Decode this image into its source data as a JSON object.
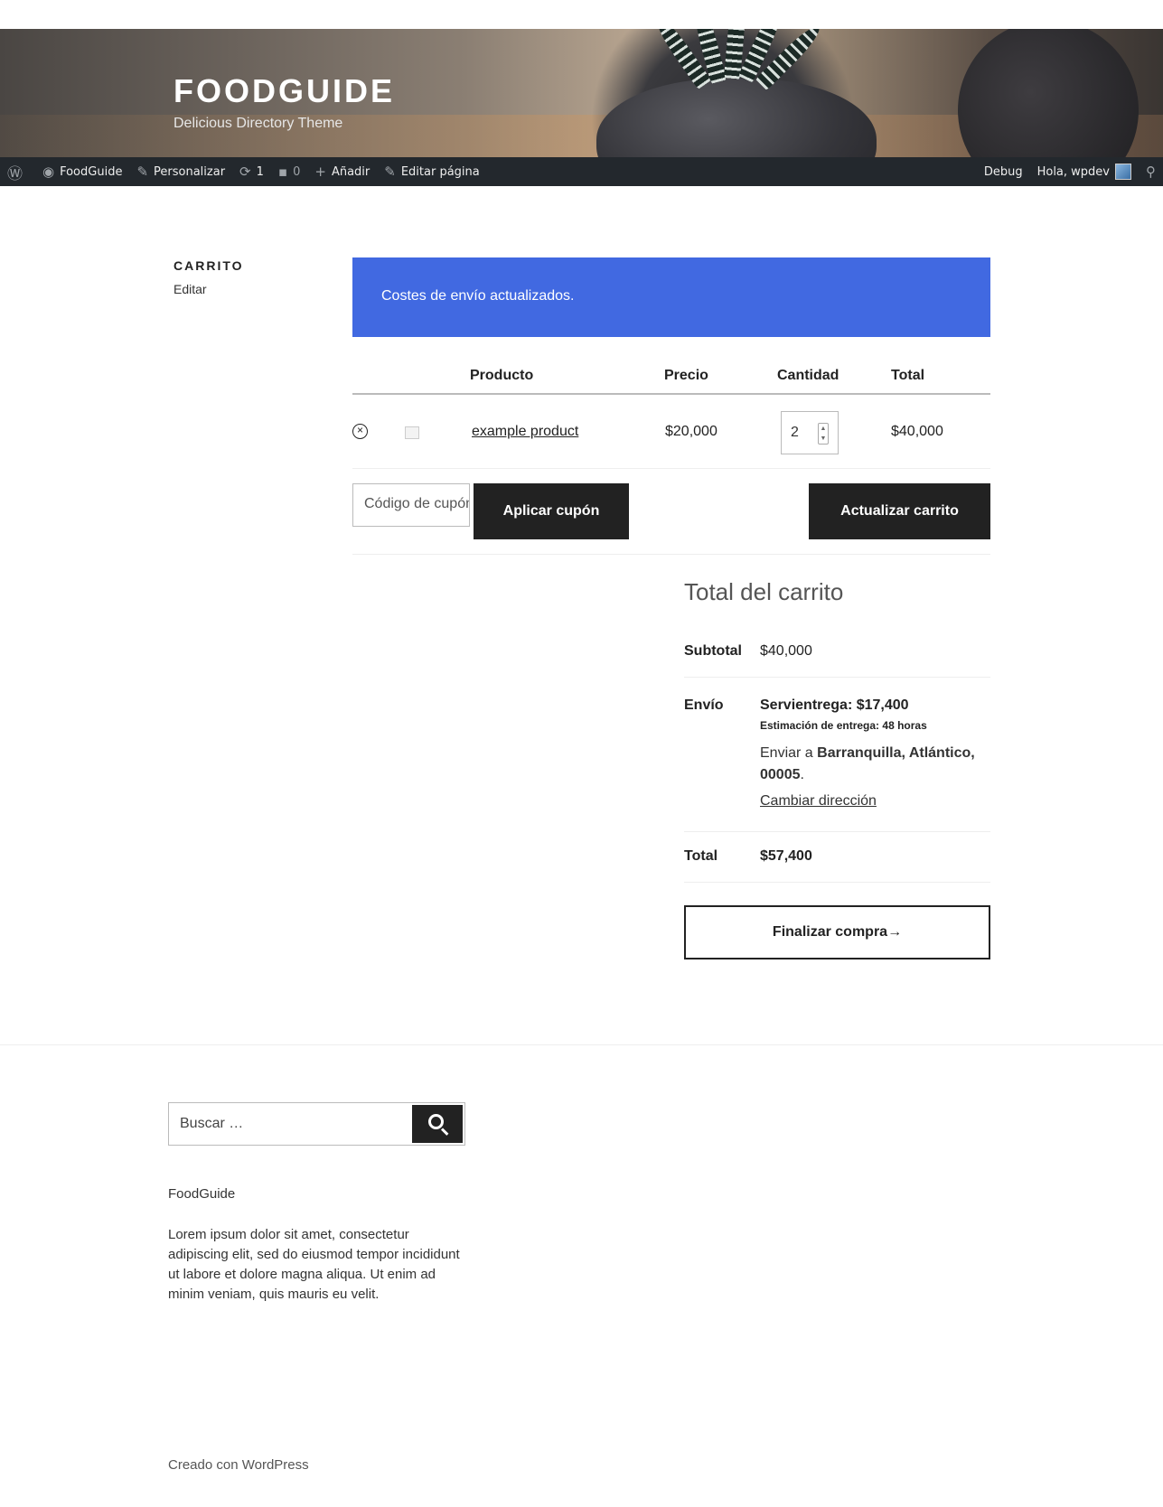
{
  "site": {
    "title": "FOODGUIDE",
    "description": "Delicious Directory Theme"
  },
  "adminbar": {
    "wp_logo_icon": "wordpress-logo-icon",
    "site_name": "FoodGuide",
    "customize": "Personalizar",
    "updates_count": "1",
    "comments_count": "0",
    "add_new": "Añadir",
    "edit_page": "Editar página",
    "debug": "Debug",
    "greeting": "Hola, wpdev"
  },
  "page": {
    "heading": "CARRITO",
    "edit_link": "Editar"
  },
  "notice": {
    "message": "Costes de envío actualizados.",
    "color": "#4169e1"
  },
  "cart": {
    "columns": [
      "Producto",
      "Precio",
      "Cantidad",
      "Total"
    ],
    "items": [
      {
        "name": "example product",
        "price": "$20,000",
        "quantity": "2",
        "total": "$40,000"
      }
    ],
    "coupon_placeholder": "Código de cupón",
    "apply_coupon": "Aplicar cupón",
    "update_cart": "Actualizar carrito"
  },
  "totals": {
    "title": "Total del carrito",
    "subtotal_label": "Subtotal",
    "subtotal_value": "$40,000",
    "shipping_label": "Envío",
    "shipping_method": "Servientrega: $17,400",
    "eta_label": "Estimación de entrega:",
    "eta_value": "48 horas",
    "ship_to_prefix": "Enviar a",
    "ship_to_address": "Barranquilla, Atlántico, 00005",
    "ship_to_suffix": ".",
    "change_address": "Cambiar dirección",
    "total_label": "Total",
    "total_value": "$57,400",
    "checkout": "Finalizar compra",
    "checkout_arrow": "→"
  },
  "footer": {
    "search_placeholder": "Buscar …",
    "widget_title": "FoodGuide",
    "widget_text": "Lorem ipsum dolor sit amet, consectetur adipiscing elit, sed do eiusmod tempor incididunt ut labore et dolore magna aliqua. Ut enim ad minim veniam, quis mauris eu velit.",
    "credit": "Creado con WordPress"
  }
}
